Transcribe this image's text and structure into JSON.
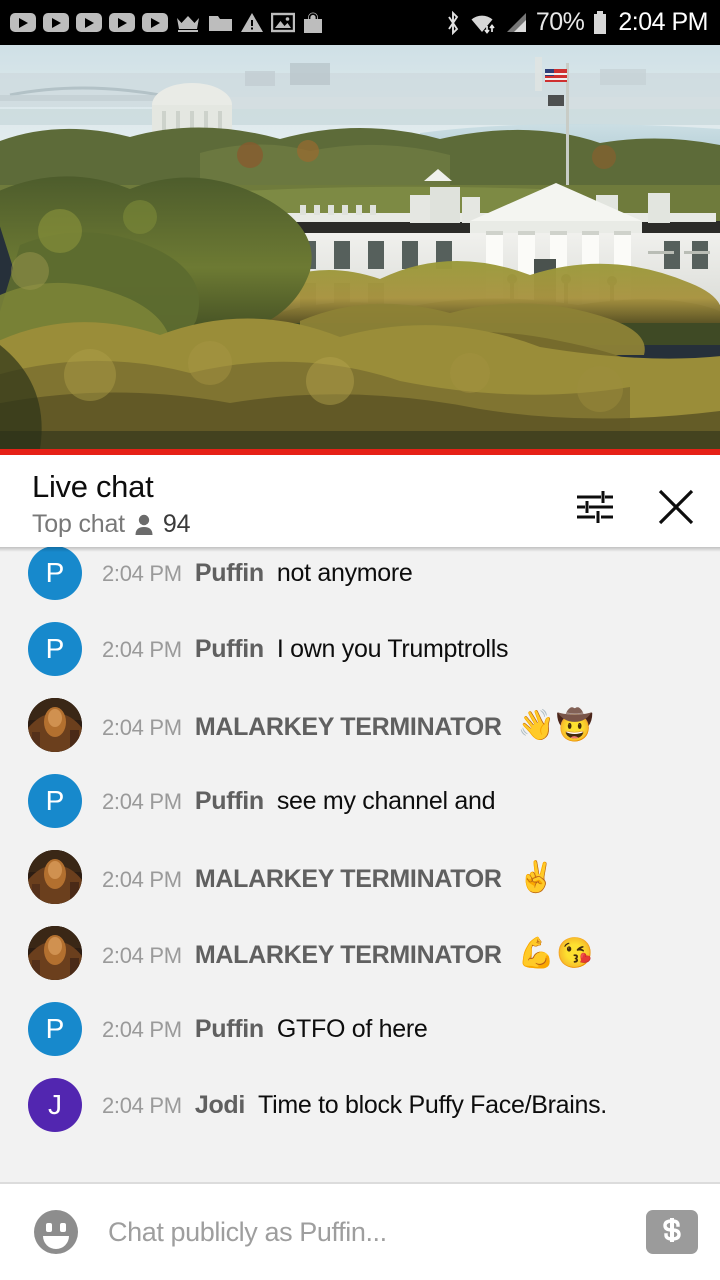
{
  "status_bar": {
    "time": "2:04 PM",
    "battery_percent": "70%",
    "icons": [
      "youtube-play-icon",
      "youtube-play-icon",
      "youtube-play-icon",
      "youtube-play-icon",
      "youtube-play-icon",
      "crown-icon",
      "folder-icon",
      "warning-icon",
      "image-icon",
      "shopping-bag-icon",
      "bluetooth-icon",
      "wifi-icon",
      "cellular-signal-icon",
      "battery-icon"
    ]
  },
  "video": {
    "alt": "Live stream of the White House in Washington DC at daytime",
    "progress_percent": 100,
    "progress_color": "#e62117"
  },
  "chat_header": {
    "title": "Live chat",
    "mode_label": "Top chat",
    "viewer_icon": "person-icon",
    "viewer_count": "94",
    "settings_icon": "chat-settings-sliders-icon",
    "close_icon": "close-icon"
  },
  "messages": [
    {
      "time": "2:04 PM",
      "author": "Puffin",
      "text": "not anymore",
      "is_emoji": false,
      "avatar_type": "initial",
      "avatar_initial": "P",
      "avatar_color": "#1789CC"
    },
    {
      "time": "2:04 PM",
      "author": "Puffin",
      "text": "I own you Trumptrolls",
      "is_emoji": false,
      "avatar_type": "initial",
      "avatar_initial": "P",
      "avatar_color": "#1789CC"
    },
    {
      "time": "2:04 PM",
      "author": "MALARKEY TERMINATOR",
      "text": "👋🤠",
      "is_emoji": true,
      "avatar_type": "photo",
      "avatar_initial": "",
      "avatar_color": "#3a2418"
    },
    {
      "time": "2:04 PM",
      "author": "Puffin",
      "text": "see my channel and",
      "is_emoji": false,
      "avatar_type": "initial",
      "avatar_initial": "P",
      "avatar_color": "#1789CC"
    },
    {
      "time": "2:04 PM",
      "author": "MALARKEY TERMINATOR",
      "text": "✌️",
      "is_emoji": true,
      "avatar_type": "photo",
      "avatar_initial": "",
      "avatar_color": "#3a2418"
    },
    {
      "time": "2:04 PM",
      "author": "MALARKEY TERMINATOR",
      "text": "💪😘",
      "is_emoji": true,
      "avatar_type": "photo",
      "avatar_initial": "",
      "avatar_color": "#3a2418"
    },
    {
      "time": "2:04 PM",
      "author": "Puffin",
      "text": "GTFO of here",
      "is_emoji": false,
      "avatar_type": "initial",
      "avatar_initial": "P",
      "avatar_color": "#1789CC"
    },
    {
      "time": "2:04 PM",
      "author": "Jodi",
      "text": "Time to block Puffy Face/Brains.",
      "is_emoji": false,
      "avatar_type": "initial",
      "avatar_initial": "J",
      "avatar_color": "#5226B0"
    }
  ],
  "input_bar": {
    "emoji_icon": "emoji-smiley-icon",
    "placeholder": "Chat publicly as Puffin...",
    "value": "",
    "superchat_icon": "dollar-sign-icon"
  }
}
